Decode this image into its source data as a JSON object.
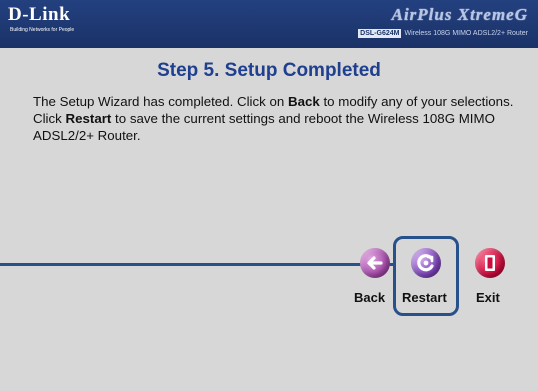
{
  "header": {
    "logo": "D-Link",
    "logo_tagline": "Building Networks for People",
    "brand": "AirPlus XtremeG",
    "model_badge": "DSL-G624M",
    "model_desc": "Wireless 108G MIMO ADSL2/2+ Router"
  },
  "wizard": {
    "title": "Step 5. Setup Completed",
    "desc_1": "The Setup Wizard has completed. Click on ",
    "desc_back": "Back",
    "desc_2": " to modify any of your selections. Click ",
    "desc_restart": "Restart",
    "desc_3": " to save the current settings and reboot the Wireless 108G MIMO ADSL2/2+ Router."
  },
  "buttons": {
    "back": "Back",
    "restart": "Restart",
    "exit": "Exit"
  },
  "icons": {
    "back": "back-arrow-icon",
    "restart": "restart-swirl-icon",
    "exit": "exit-door-icon"
  },
  "colors": {
    "header_bg": "#1b3268",
    "panel_bg": "#d7d7d7",
    "title": "#1f3f8f",
    "highlight": "#27518a",
    "back_icon": "#a44aa8",
    "restart_icon": "#7d45b8",
    "exit_icon": "#cc0b3d"
  }
}
